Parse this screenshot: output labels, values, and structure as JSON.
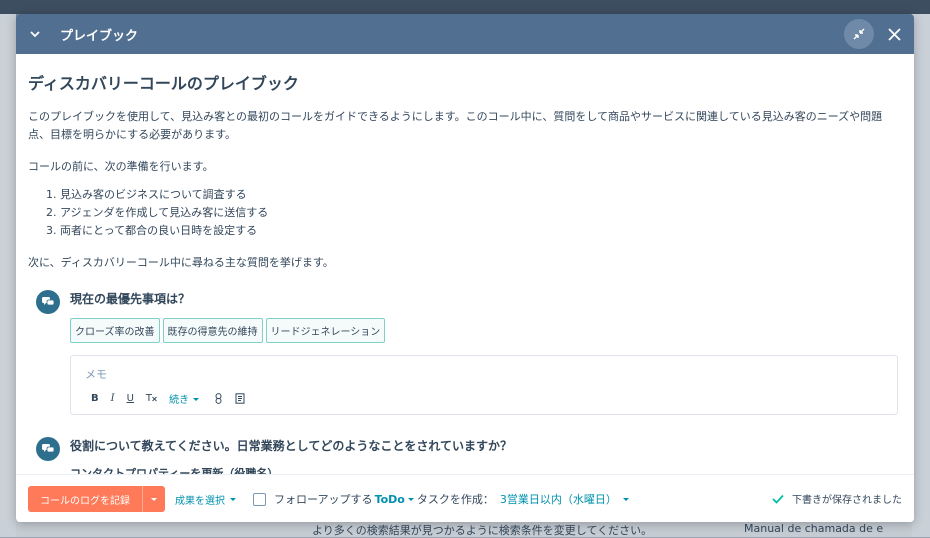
{
  "background": {
    "bottom_text": "より多くの検索結果が見つかるように検索条件を変更してください。",
    "bottom_right_text": "Manual de chamada de e"
  },
  "header": {
    "title": "プレイブック"
  },
  "playbook": {
    "title": "ディスカバリーコールのプレイブック",
    "intro": "このプレイブックを使用して、見込み客との最初のコールをガイドできるようにします。このコール中に、質問をして商品やサービスに関連している見込み客のニーズや問題点、目標を明らかにする必要があります。",
    "prep_lead": "コールの前に、次の準備を行います。",
    "steps": [
      "1. 見込み客のビジネスについて調査する",
      "2. アジェンダを作成して見込み客に送信する",
      "3. 両者にとって都合の良い日時を設定する"
    ],
    "questions_lead": "次に、ディスカバリーコール中に尋ねる主な質問を挙げます。",
    "question1": {
      "title": "現在の最優先事項は？",
      "tags": [
        "クローズ率の改善",
        "既存の得意先の維持",
        "リードジェネレーション"
      ],
      "memo_placeholder": "メモ",
      "toolbar": {
        "bold": "B",
        "italic": "I",
        "underline": "U",
        "clear": "T",
        "more": "続き"
      }
    },
    "question2": {
      "title": "役割について教えてください。日常業務としてどのようなことをされていますか？",
      "property_label": "コンタクトプロパティーを更新（役職名）"
    }
  },
  "footer": {
    "log_button": "コールのログを記録",
    "outcome": "成果を選択",
    "followup_label": "フォローアップする",
    "followup_type": "ToDo",
    "task_label": "タスクを作成：",
    "task_due": "3営業日以内（水曜日）",
    "saved_status": "下書きが保存されました"
  },
  "colors": {
    "header_bg": "#516f90",
    "accent": "#ff7a59",
    "link": "#0091ae",
    "tag_border": "#7fd1c7",
    "success": "#00bda5"
  }
}
